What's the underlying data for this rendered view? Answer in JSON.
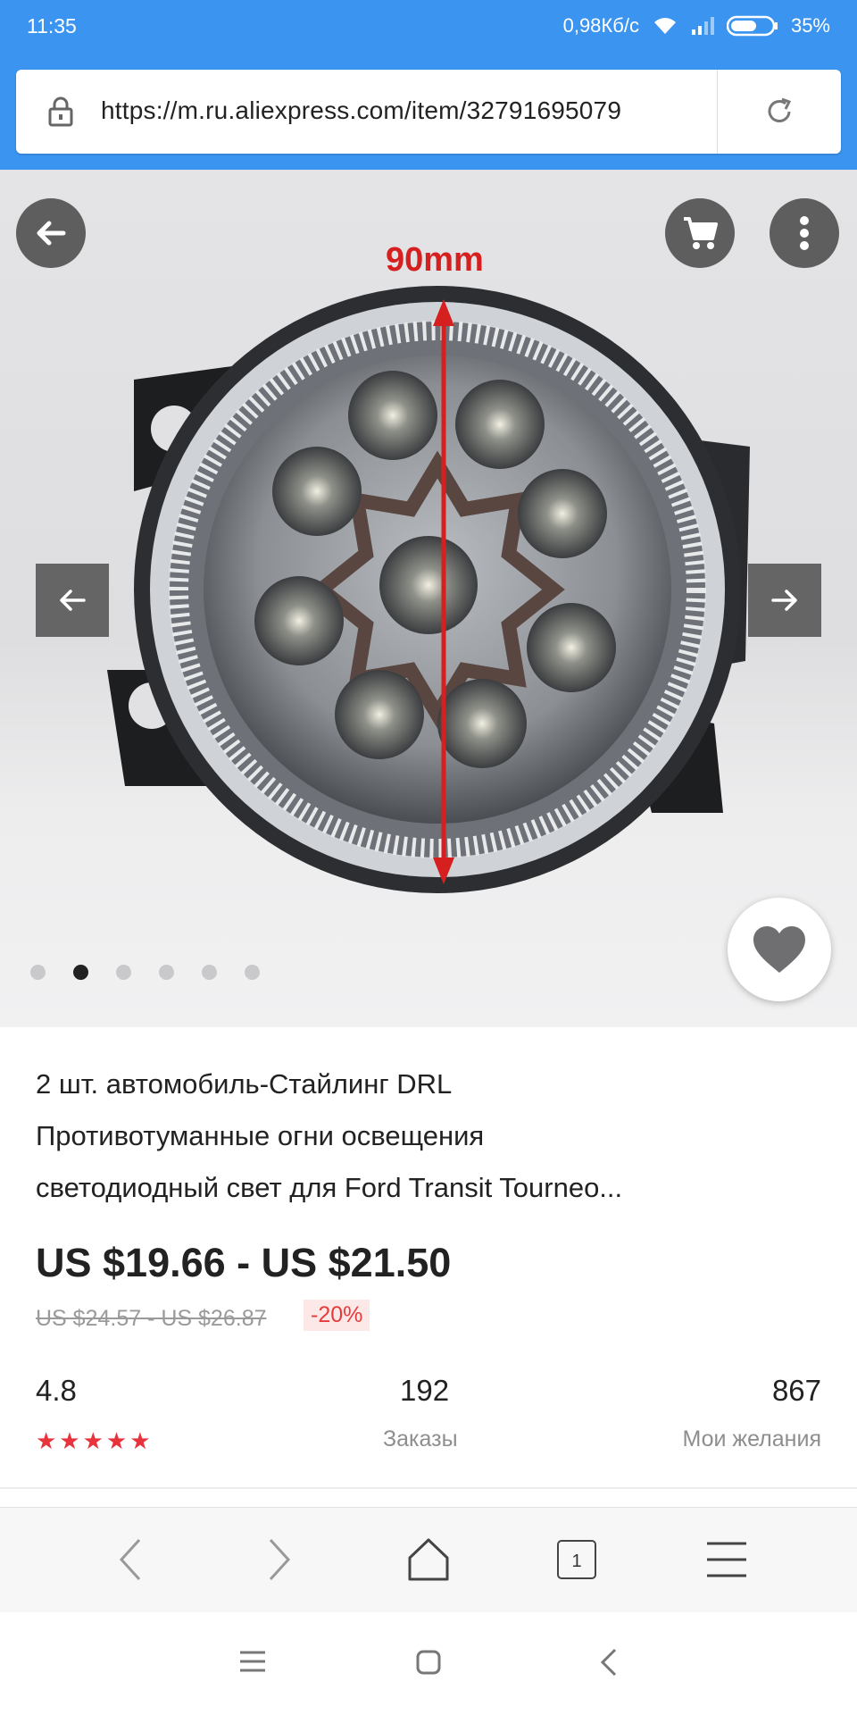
{
  "status_bar": {
    "time": "11:35",
    "network_speed": "0,98Кб/с",
    "battery": "35%"
  },
  "address_bar": {
    "url": "https://m.ru.aliexpress.com/item/32791695079"
  },
  "gallery": {
    "measure_label": "90mm",
    "image_count": 6,
    "active_index": 1
  },
  "product": {
    "title_lines": [
      "2 шт. автомобиль-Стайлинг DRL",
      "Противотуманные огни освещения",
      "светодиодный свет для Ford Transit Tourneo..."
    ],
    "price_range": "US $19.66 - US $21.50",
    "old_price_range": "US $24.57 - US $26.87",
    "discount": "-20%"
  },
  "stats": {
    "rating": "4.8",
    "rating_stars": "★★★★★",
    "orders_count": "192",
    "orders_label": "Заказы",
    "wishlist_count": "867",
    "wishlist_label": "Мои желания"
  },
  "toolbar": {
    "tabs_count": "1"
  },
  "colors": {
    "chrome_blue": "#3b94f0",
    "price_red": "#e43b3b",
    "star_red": "#e8323c",
    "measure_red": "#d62020"
  }
}
